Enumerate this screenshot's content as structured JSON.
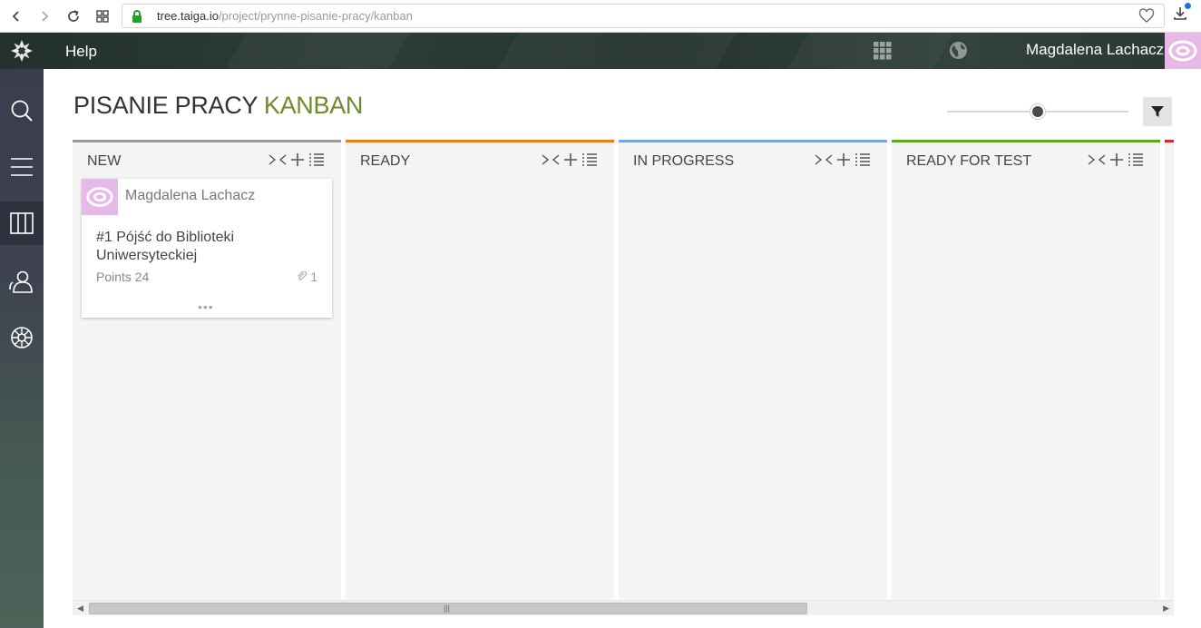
{
  "browser": {
    "url_host": "tree.taiga.io",
    "url_path": "/project/prynne-pisanie-pracy/kanban"
  },
  "topbar": {
    "help_label": "Help",
    "user_name": "Magdalena Lachacz"
  },
  "sidebar": {
    "items": [
      {
        "icon": "search-icon"
      },
      {
        "icon": "menu-icon"
      },
      {
        "icon": "kanban-icon",
        "active": true
      },
      {
        "icon": "team-icon"
      },
      {
        "icon": "settings-icon"
      }
    ]
  },
  "page": {
    "title_main": "PISANIE PRACY",
    "title_accent": "KANBAN"
  },
  "zoom": {
    "level_fraction": 0.5
  },
  "columns": [
    {
      "title": "NEW",
      "color": "#999999"
    },
    {
      "title": "READY",
      "color": "#e87e1a"
    },
    {
      "title": "IN PROGRESS",
      "color": "#79a5dd"
    },
    {
      "title": "READY FOR TEST",
      "color": "#5ba91f"
    },
    {
      "title": "",
      "color": "#d6262c"
    }
  ],
  "card": {
    "owner": "Magdalena Lachacz",
    "task": "#1 Pójść do Biblioteki Uniwersyteckiej",
    "points": "Points 24",
    "attachments": "1",
    "more": "•••"
  },
  "colors": {
    "accent": "#6f8a2f",
    "avatar": "#e7b9e8"
  }
}
